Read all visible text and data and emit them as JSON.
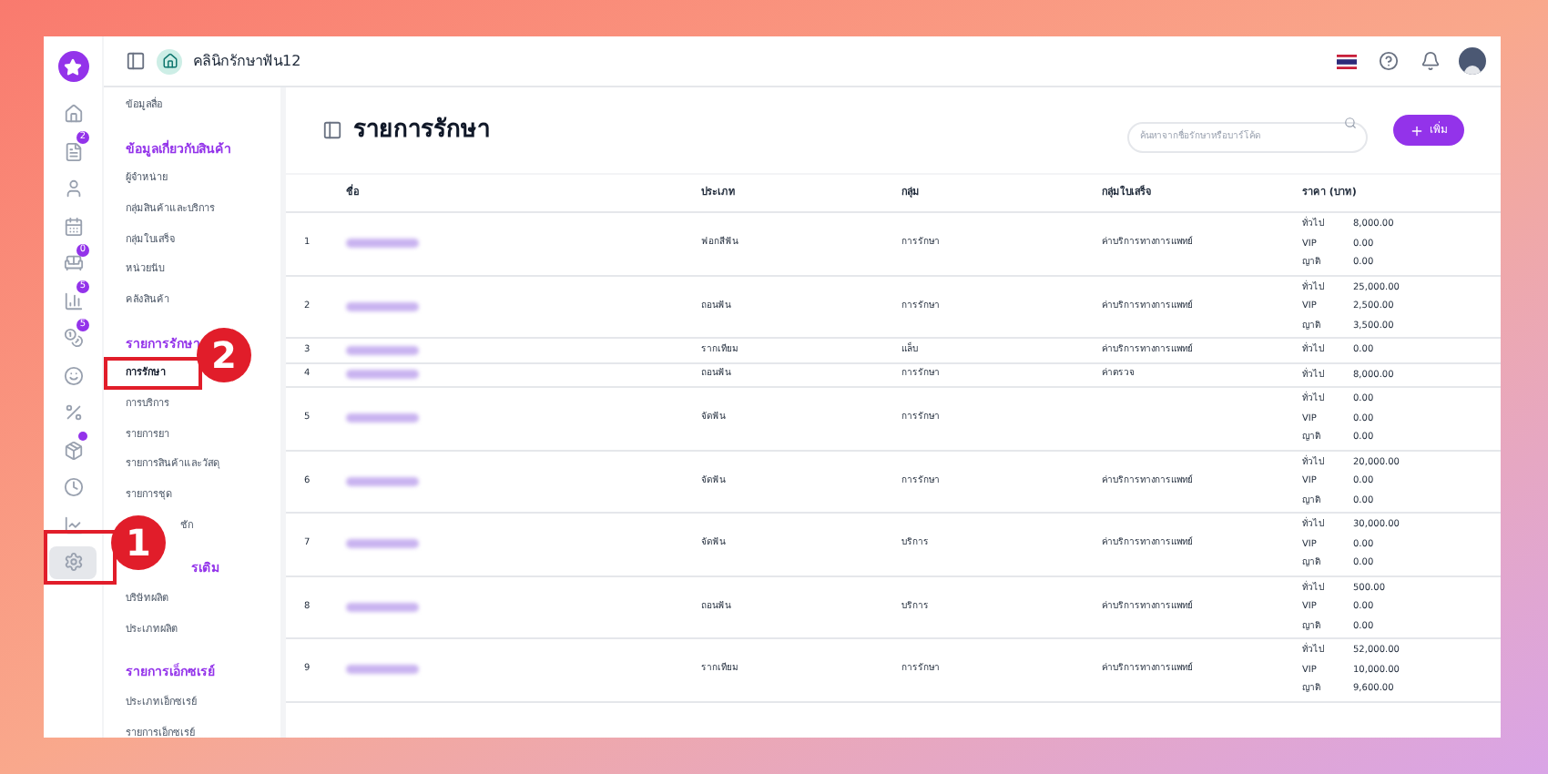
{
  "header": {
    "clinic_name": "คลินิกรักษาฟัน12"
  },
  "rail": [
    {
      "selected": false
    },
    {
      "badge": "2",
      "selected": false
    },
    {
      "selected": false
    },
    {
      "selected": false
    },
    {
      "badge": "0",
      "selected": false
    },
    {
      "badge": "5",
      "selected": false
    },
    {
      "badge": "5",
      "selected": false
    },
    {
      "selected": false
    },
    {
      "selected": false
    },
    {
      "dot": true,
      "selected": false
    },
    {
      "selected": false
    },
    {
      "selected": false
    },
    {
      "selected": true
    }
  ],
  "submenu": [
    {
      "kind": "item",
      "label": "ข้อมูลสื่อ",
      "selected": false
    },
    {
      "kind": "heading",
      "label": "ข้อมูลเกี่ยวกับสินค้า"
    },
    {
      "kind": "item",
      "label": "ผู้จำหน่าย",
      "selected": false
    },
    {
      "kind": "item",
      "label": "กลุ่มสินค้าและบริการ",
      "selected": false
    },
    {
      "kind": "item",
      "label": "กลุ่มใบเสร็จ",
      "selected": false
    },
    {
      "kind": "item",
      "label": "หน่วยนับ",
      "selected": false
    },
    {
      "kind": "item",
      "label": "คลังสินค้า",
      "selected": false
    },
    {
      "kind": "heading",
      "label": "รายการรักษา"
    },
    {
      "kind": "item",
      "label": "การรักษา",
      "selected": true
    },
    {
      "kind": "item",
      "label": "การบริการ",
      "selected": false
    },
    {
      "kind": "item",
      "label": "รายการยา",
      "selected": false
    },
    {
      "kind": "item",
      "label": "รายการสินค้าและวัสดุ",
      "selected": false
    },
    {
      "kind": "item",
      "label": "รายการชุด",
      "selected": false
    },
    {
      "kind": "item",
      "label": "ชัก",
      "selected": false,
      "covered": true
    },
    {
      "kind": "heading",
      "label": "รเติม",
      "covered": true
    },
    {
      "kind": "item",
      "label": "บริษัทผลิต",
      "selected": false
    },
    {
      "kind": "item",
      "label": "ประเภทผลิต",
      "selected": false
    },
    {
      "kind": "heading",
      "label": "รายการเอ็กซเรย์"
    },
    {
      "kind": "item",
      "label": "ประเภทเอ็กซเรย์",
      "selected": false
    },
    {
      "kind": "item",
      "label": "รายการเอ็กซเรย์",
      "selected": false
    }
  ],
  "page": {
    "title": "รายการรักษา",
    "search": {
      "placeholder": "ค้นหาจากชื่อรักษาหรือบาร์โค้ด"
    },
    "add_button": "เพิ่ม"
  },
  "table": {
    "columns": [
      "ชื่อ",
      "ประเภท",
      "กลุ่ม",
      "กลุ่มใบเสร็จ",
      "ราคา (บาท)"
    ],
    "rows": [
      {
        "no": "1",
        "type": "ฟอกสีฟัน",
        "group": "การรักษา",
        "receipt_group": "ค่าบริการทางการแพทย์",
        "prices": [
          [
            "ทั่วไป",
            "8,000.00"
          ],
          [
            "VIP",
            "0.00"
          ],
          [
            "ญาติ",
            "0.00"
          ]
        ]
      },
      {
        "no": "2",
        "type": "ถอนฟัน",
        "group": "การรักษา",
        "receipt_group": "ค่าบริการทางการแพทย์",
        "prices": [
          [
            "ทั่วไป",
            "25,000.00"
          ],
          [
            "VIP",
            "2,500.00"
          ],
          [
            "ญาติ",
            "3,500.00"
          ]
        ]
      },
      {
        "no": "3",
        "type": "รากเทียม",
        "group": "แล็บ",
        "receipt_group": "ค่าบริการทางการแพทย์",
        "prices": [
          [
            "ทั่วไป",
            "0.00"
          ]
        ]
      },
      {
        "no": "4",
        "type": "ถอนฟัน",
        "group": "การรักษา",
        "receipt_group": "ค่าตรวจ",
        "prices": [
          [
            "ทั่วไป",
            "8,000.00"
          ]
        ]
      },
      {
        "no": "5",
        "type": "จัดฟัน",
        "group": "การรักษา",
        "prices": [
          [
            "ทั่วไป",
            "0.00"
          ],
          [
            "VIP",
            "0.00"
          ],
          [
            "ญาติ",
            "0.00"
          ]
        ]
      },
      {
        "no": "6",
        "type": "จัดฟัน",
        "group": "การรักษา",
        "receipt_group": "ค่าบริการทางการแพทย์",
        "prices": [
          [
            "ทั่วไป",
            "20,000.00"
          ],
          [
            "VIP",
            "0.00"
          ],
          [
            "ญาติ",
            "0.00"
          ]
        ]
      },
      {
        "no": "7",
        "type": "จัดฟัน",
        "group": "บริการ",
        "receipt_group": "ค่าบริการทางการแพทย์",
        "prices": [
          [
            "ทั่วไป",
            "30,000.00"
          ],
          [
            "VIP",
            "0.00"
          ],
          [
            "ญาติ",
            "0.00"
          ]
        ]
      },
      {
        "no": "8",
        "type": "ถอนฟัน",
        "group": "บริการ",
        "receipt_group": "ค่าบริการทางการแพทย์",
        "prices": [
          [
            "ทั่วไป",
            "500.00"
          ],
          [
            "VIP",
            "0.00"
          ],
          [
            "ญาติ",
            "0.00"
          ]
        ]
      },
      {
        "no": "9",
        "type": "รากเทียม",
        "group": "การรักษา",
        "receipt_group": "ค่าบริการทางการแพทย์",
        "prices": [
          [
            "ทั่วไป",
            "52,000.00"
          ],
          [
            "VIP",
            "10,000.00"
          ],
          [
            "ญาติ",
            "9,600.00"
          ]
        ]
      }
    ]
  },
  "annotations": [
    {
      "label": "1"
    },
    {
      "label": "2"
    }
  ]
}
